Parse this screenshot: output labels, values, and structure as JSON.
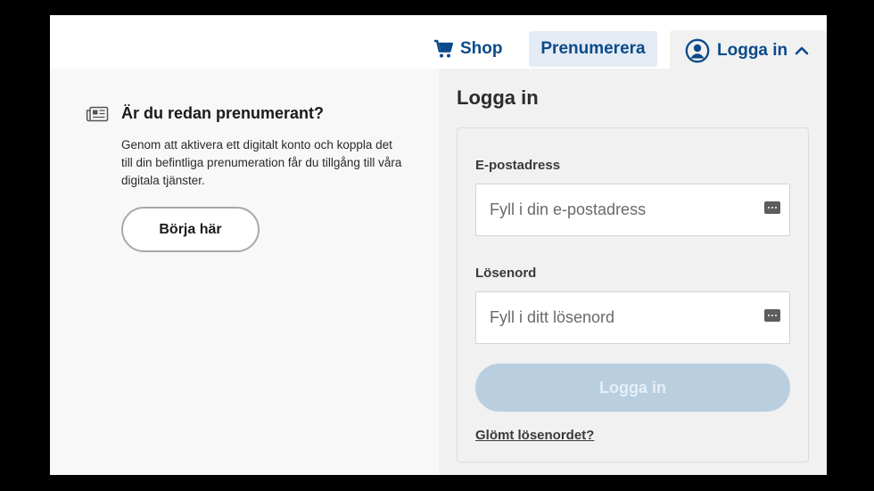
{
  "nav": {
    "shop_label": "Shop",
    "shop_icon": "shopping-cart-icon",
    "subscribe_label": "Prenumerera",
    "login_label": "Logga in",
    "login_icon": "user-circle-icon",
    "login_toggle_icon": "chevron-up-icon"
  },
  "subscriber": {
    "icon": "newspaper-icon",
    "heading": "Är du redan prenumerant?",
    "body": "Genom att aktivera ett digitalt konto och koppla det till din befintliga prenumeration får du tillgång till våra digitala tjänster.",
    "button_label": "Börja här"
  },
  "login": {
    "title": "Logga in",
    "email_label": "E-postadress",
    "email_placeholder": "Fyll i din e-postadress",
    "email_value": "",
    "password_label": "Lösenord",
    "password_placeholder": "Fyll i ditt lösenord",
    "password_value": "",
    "submit_label": "Logga in",
    "forgot_label": "Glömt lösenordet?"
  },
  "colors": {
    "brand": "#0a4a8a",
    "subscribe_bg": "#e4ebf4",
    "submit_disabled_bg": "#b9cfe0"
  }
}
